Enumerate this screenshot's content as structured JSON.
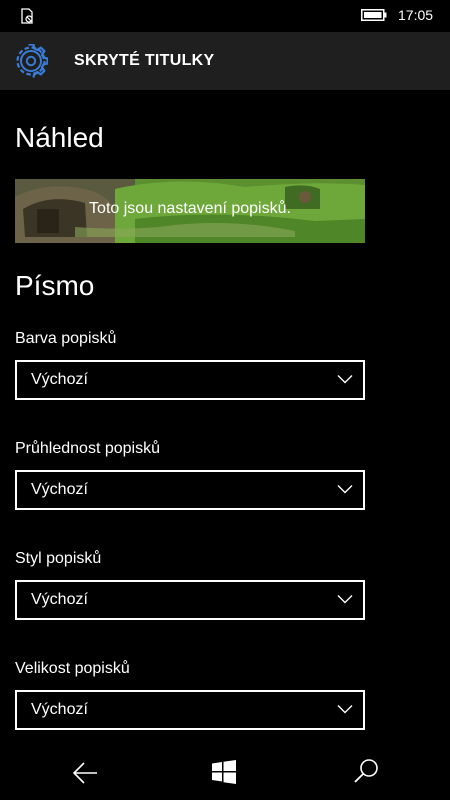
{
  "status_bar": {
    "time": "17:05",
    "icons": [
      "notification-icon",
      "battery-icon"
    ]
  },
  "header": {
    "title": "SKRYTÉ TITULKY",
    "icon": "gear-icon",
    "accent_color": "#3a7bd5"
  },
  "preview": {
    "heading": "Náhled",
    "caption": "Toto jsou nastavení popisků."
  },
  "font_section": {
    "heading": "Písmo",
    "fields": [
      {
        "label": "Barva popisků",
        "value": "Výchozí"
      },
      {
        "label": "Průhlednost popisků",
        "value": "Výchozí"
      },
      {
        "label": "Styl popisků",
        "value": "Výchozí"
      },
      {
        "label": "Velikost popisků",
        "value": "Výchozí"
      }
    ]
  },
  "nav_bar": {
    "icons": [
      "back-arrow-icon",
      "windows-start-icon",
      "search-icon"
    ]
  }
}
